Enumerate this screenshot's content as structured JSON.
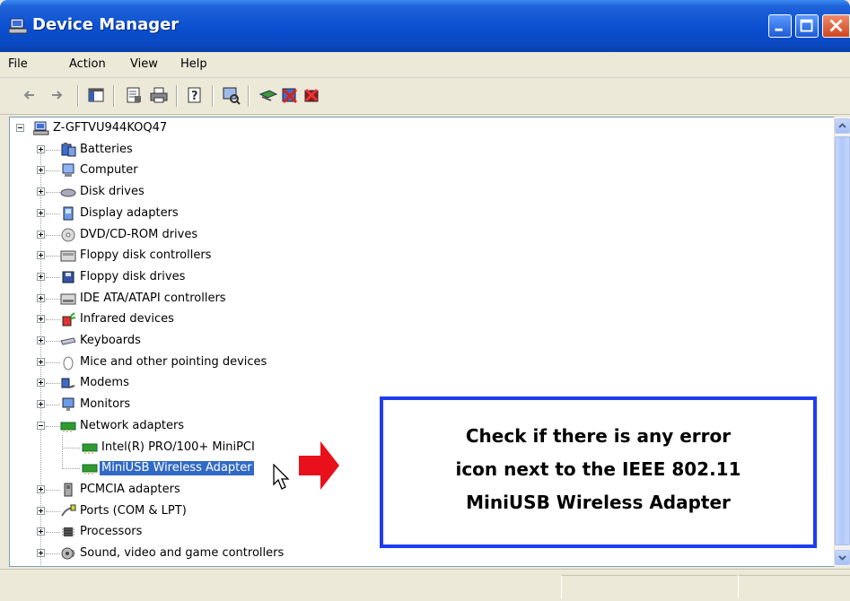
{
  "window": {
    "title": "Device Manager",
    "controls": {
      "minimize": "minimize-icon",
      "maximize": "maximize-icon",
      "close": "close-icon"
    }
  },
  "menu": [
    "File",
    "Action",
    "View",
    "Help"
  ],
  "toolbar": {
    "icons": [
      "back-icon",
      "forward-icon",
      "show-hide-console-tree-icon",
      "properties-icon",
      "print-icon",
      "help-icon",
      "scan-hardware-icon",
      "update-driver-icon",
      "disable-device-icon",
      "uninstall-icon"
    ]
  },
  "tree": {
    "root": "Z-GFTVU944KOQ47",
    "categories": [
      {
        "label": "Batteries",
        "icon": "battery-icon"
      },
      {
        "label": "Computer",
        "icon": "computer-icon"
      },
      {
        "label": "Disk drives",
        "icon": "disk-drive-icon"
      },
      {
        "label": "Display adapters",
        "icon": "display-adapter-icon"
      },
      {
        "label": "DVD/CD-ROM drives",
        "icon": "cd-rom-icon"
      },
      {
        "label": "Floppy disk controllers",
        "icon": "floppy-controller-icon"
      },
      {
        "label": "Floppy disk drives",
        "icon": "floppy-drive-icon"
      },
      {
        "label": "IDE ATA/ATAPI controllers",
        "icon": "ide-controller-icon"
      },
      {
        "label": "Infrared devices",
        "icon": "infrared-icon"
      },
      {
        "label": "Keyboards",
        "icon": "keyboard-icon"
      },
      {
        "label": "Mice and other pointing devices",
        "icon": "mouse-icon"
      },
      {
        "label": "Modems",
        "icon": "modem-icon"
      },
      {
        "label": "Monitors",
        "icon": "monitor-icon"
      },
      {
        "label": "Network adapters",
        "icon": "network-adapter-icon"
      },
      {
        "label": "PCMCIA adapters",
        "icon": "pcmcia-icon"
      },
      {
        "label": "Ports (COM & LPT)",
        "icon": "port-icon"
      },
      {
        "label": "Processors",
        "icon": "processor-icon"
      },
      {
        "label": "Sound, video and game controllers",
        "icon": "sound-icon"
      }
    ],
    "network_children": [
      "Intel(R) PRO/100+ MiniPCI",
      "MiniUSB Wireless Adapter"
    ],
    "selected": "MiniUSB Wireless Adapter"
  },
  "callout": {
    "lines": [
      "Check if there is any error",
      "icon next to the IEEE 802.11",
      "MiniUSB Wireless Adapter"
    ],
    "border_color": "#1e3cf0"
  },
  "colors": {
    "titlebar": "#0a4fd0",
    "selection": "#316ac5",
    "arrow": "#e8101a"
  }
}
